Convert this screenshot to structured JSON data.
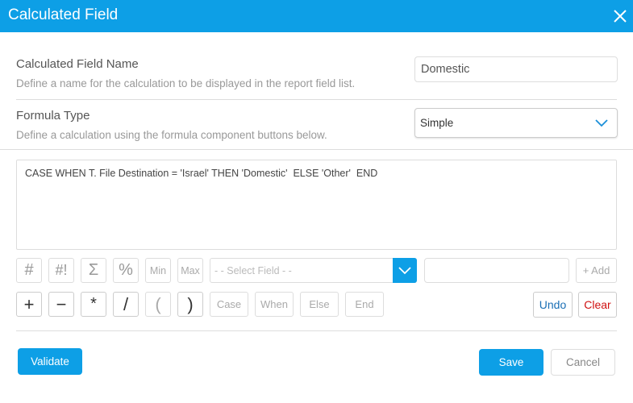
{
  "dialog": {
    "title": "Calculated Field",
    "close_icon": "close-icon",
    "accent_color": "#0d9fe6"
  },
  "name_section": {
    "title": "Calculated Field Name",
    "description": "Define a name for the calculation to be displayed in the report field list.",
    "value": "Domestic"
  },
  "formula_type_section": {
    "title": "Formula Type",
    "description": "Define a calculation using the formula component buttons below.",
    "selected": "Simple"
  },
  "formula": {
    "text": "CASE WHEN T. File Destination = 'Israel' THEN 'Domestic'  ELSE 'Other'  END"
  },
  "toolbar": {
    "row1": [
      "#",
      "#!",
      "Σ",
      "%",
      "Min",
      "Max"
    ],
    "row2": [
      "+",
      "−",
      "*",
      "/",
      "(",
      ")",
      "Case",
      "When",
      "Else",
      "End"
    ],
    "field_select_placeholder": "- - Select Field - -",
    "add_label": "+ Add",
    "undo_label": "Undo",
    "clear_label": "Clear",
    "undo_color": "#1a6fb5",
    "clear_color": "#d01111"
  },
  "footer": {
    "validate_label": "Validate",
    "save_label": "Save",
    "cancel_label": "Cancel"
  }
}
